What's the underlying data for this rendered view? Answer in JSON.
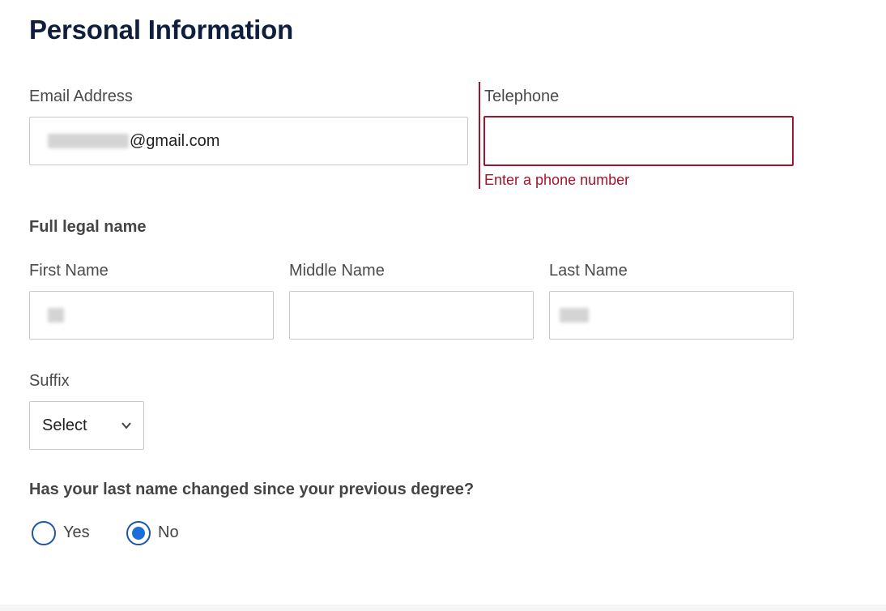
{
  "page": {
    "title": "Personal Information"
  },
  "contact": {
    "email_label": "Email Address",
    "email_value_visible_suffix": "@gmail.com",
    "telephone_label": "Telephone",
    "telephone_value": "",
    "telephone_error": "Enter a phone number"
  },
  "name": {
    "section_heading": "Full legal name",
    "first_label": "First Name",
    "middle_label": "Middle Name",
    "middle_value": "",
    "last_label": "Last Name",
    "suffix_label": "Suffix",
    "suffix_selected": "Select"
  },
  "name_change": {
    "question": "Has your last name changed since your previous degree?",
    "options": [
      {
        "label": "Yes",
        "checked": false
      },
      {
        "label": "No",
        "checked": true
      }
    ]
  },
  "colors": {
    "title": "#0f1e3d",
    "error": "#a0142d",
    "radio_border": "#1a55a8",
    "radio_fill": "#1a6ed8"
  },
  "icons": {
    "suffix_dropdown": "chevron-down-icon"
  }
}
